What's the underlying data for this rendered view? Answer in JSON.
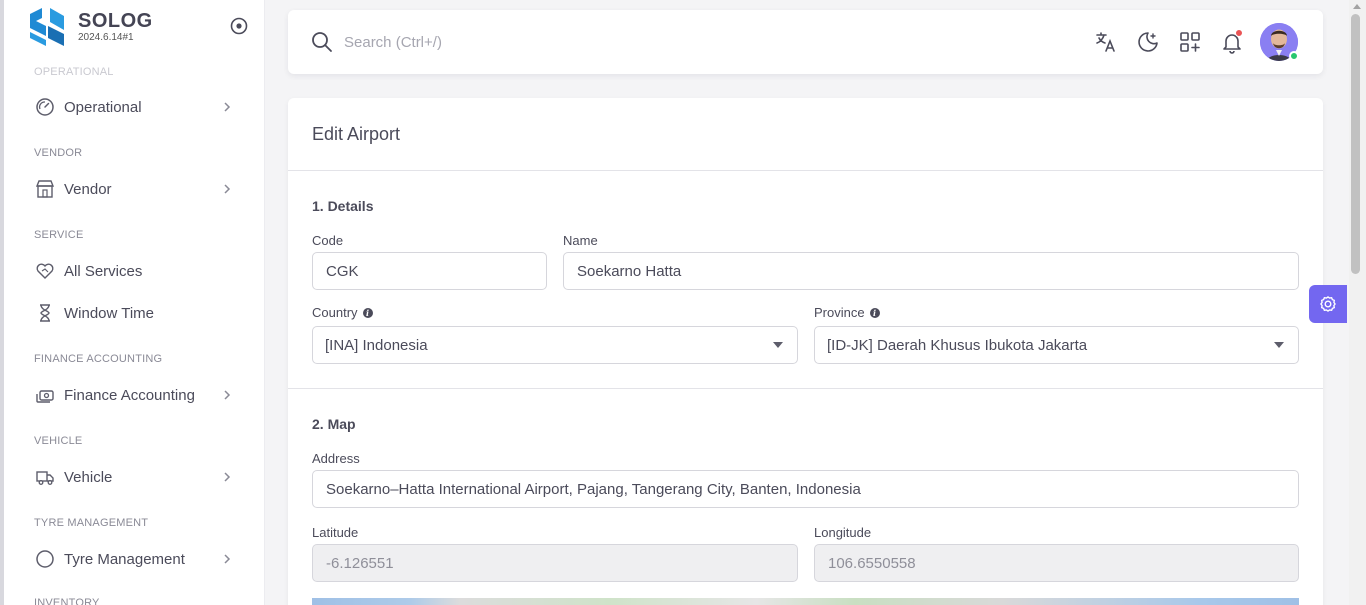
{
  "brand": {
    "name": "SOLOG",
    "version": "2024.6.14#1"
  },
  "sidebar": {
    "sections": [
      {
        "label": "OPERATIONAL"
      },
      {
        "label": "VENDOR"
      },
      {
        "label": "SERVICE"
      },
      {
        "label": "FINANCE ACCOUNTING"
      },
      {
        "label": "VEHICLE"
      },
      {
        "label": "TYRE MANAGEMENT"
      },
      {
        "label": "INVENTORY"
      }
    ],
    "items": [
      {
        "label": "Operational",
        "icon": "gauge-icon"
      },
      {
        "label": "Vendor",
        "icon": "store-icon"
      },
      {
        "label": "All Services",
        "icon": "heart-handshake-icon"
      },
      {
        "label": "Window Time",
        "icon": "hourglass-icon"
      },
      {
        "label": "Finance Accounting",
        "icon": "cash-icon"
      },
      {
        "label": "Vehicle",
        "icon": "truck-icon"
      },
      {
        "label": "Tyre Management",
        "icon": "circle-icon"
      }
    ]
  },
  "topbar": {
    "search_placeholder": "Search (Ctrl+/)"
  },
  "form": {
    "title": "Edit Airport",
    "details_title": "1. Details",
    "code_label": "Code",
    "code_value": "CGK",
    "name_label": "Name",
    "name_value": "Soekarno Hatta",
    "country_label": "Country",
    "country_value": "[INA] Indonesia",
    "province_label": "Province",
    "province_value": "[ID-JK] Daerah Khusus Ibukota Jakarta",
    "map_title": "2. Map",
    "address_label": "Address",
    "address_value": "Soekarno–Hatta International Airport, Pajang, Tangerang City, Banten, Indonesia",
    "latitude_label": "Latitude",
    "latitude_value": "-6.126551",
    "longitude_label": "Longitude",
    "longitude_value": "106.6550558"
  },
  "colors": {
    "primary": "#7367f0",
    "online": "#28c76f",
    "notification": "#ea5455",
    "brand": "#1f8ad4"
  }
}
